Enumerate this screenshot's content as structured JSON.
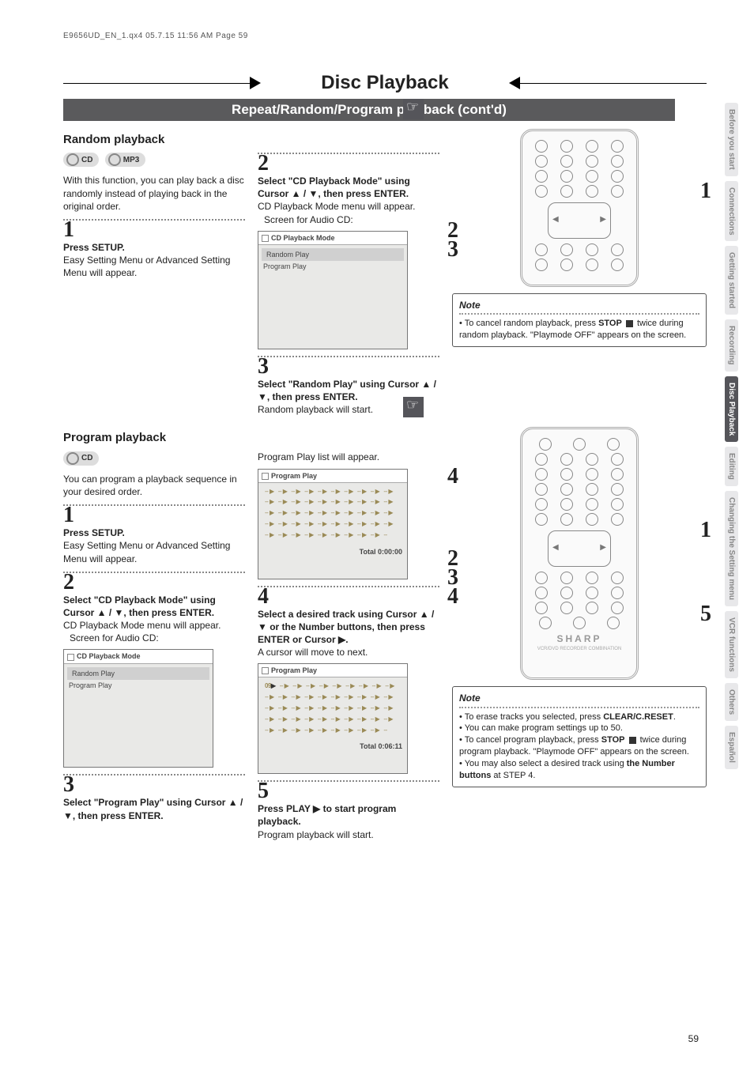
{
  "header_line": "E9656UD_EN_1.qx4  05.7.15  11:56 AM  Page 59",
  "page_title": "Disc Playback",
  "subtitle": "Repeat/Random/Program playback (cont'd)",
  "page_number": "59",
  "side_tabs": [
    "Before you start",
    "Connections",
    "Getting started",
    "Recording",
    "Disc Playback",
    "Editing",
    "Changing the Setting menu",
    "VCR functions",
    "Others",
    "Español"
  ],
  "active_tab_index": 4,
  "badges": {
    "cd": "CD",
    "mp3": "MP3"
  },
  "random": {
    "heading": "Random playback",
    "intro": "With this function, you can play back a disc randomly instead of playing back in the original order.",
    "step1_num": "1",
    "step1_title": "Press SETUP.",
    "step1_body": "Easy Setting Menu or Advanced Setting Menu will appear.",
    "step2_num": "2",
    "step2_title": "Select \"CD Playback Mode\" using Cursor ▲ / ▼, then press ENTER.",
    "step2_body": "CD Playback Mode menu will appear.",
    "step2_caption": "Screen for Audio CD:",
    "step3_num": "3",
    "step3_title": "Select \"Random Play\" using Cursor ▲ / ▼, then press ENTER.",
    "step3_body": "Random playback will start.",
    "osd_title": "CD Playback Mode",
    "osd_items": [
      "Random Play",
      "Program Play"
    ],
    "note_label": "Note",
    "note_body": "• To cancel random playback, press STOP ■ twice during random playback. \"Playmode OFF\" appears on the screen.",
    "remote_callouts": {
      "r1": "1",
      "r2": "2",
      "r3": "3"
    }
  },
  "program": {
    "heading": "Program playback",
    "intro": "You can program a playback sequence in your desired order.",
    "step1_num": "1",
    "step1_title": "Press SETUP.",
    "step1_body": "Easy Setting Menu or Advanced Setting Menu will appear.",
    "step2_num": "2",
    "step2_title": "Select \"CD Playback Mode\" using Cursor ▲ / ▼, then press ENTER.",
    "step2_body": "CD Playback Mode menu will appear.",
    "step2_caption": "Screen for Audio CD:",
    "step3_num": "3",
    "step3_title": "Select \"Program Play\" using Cursor ▲ / ▼, then press ENTER.",
    "step3_result": "Program Play list will appear.",
    "step4_num": "4",
    "step4_title": "Select a desired track using Cursor ▲ / ▼ or the Number buttons, then press ENTER or Cursor ▶.",
    "step4_body": "A cursor will move to next.",
    "step5_num": "5",
    "step5_title": "Press PLAY ▶ to start program playback.",
    "step5_body": "Program playback will start.",
    "osd_pp_title": "Program Play",
    "osd_pp_total1": "Total   0:00:00",
    "osd_pp_total2": "Total   0:06:11",
    "osd_pp_first_cell": "09",
    "osd_cd_title": "CD Playback Mode",
    "osd_cd_items": [
      "Random Play",
      "Program Play"
    ],
    "note_label": "Note",
    "notes": [
      "To erase tracks you selected, press CLEAR/C.RESET.",
      "You can make program settings up to 50.",
      "To cancel program playback, press STOP ■ twice during program playback. \"Playmode OFF\" appears on the screen.",
      "You may also select a desired track using the Number buttons at STEP 4."
    ],
    "remote_callouts": {
      "r1": "1",
      "r2": "2",
      "r3": "3",
      "r4_left": "4",
      "r4_right": "4",
      "r5": "5"
    },
    "remote_brand": "SHARP",
    "remote_brand_sub": "VCR/DVD RECORDER COMBINATION"
  }
}
